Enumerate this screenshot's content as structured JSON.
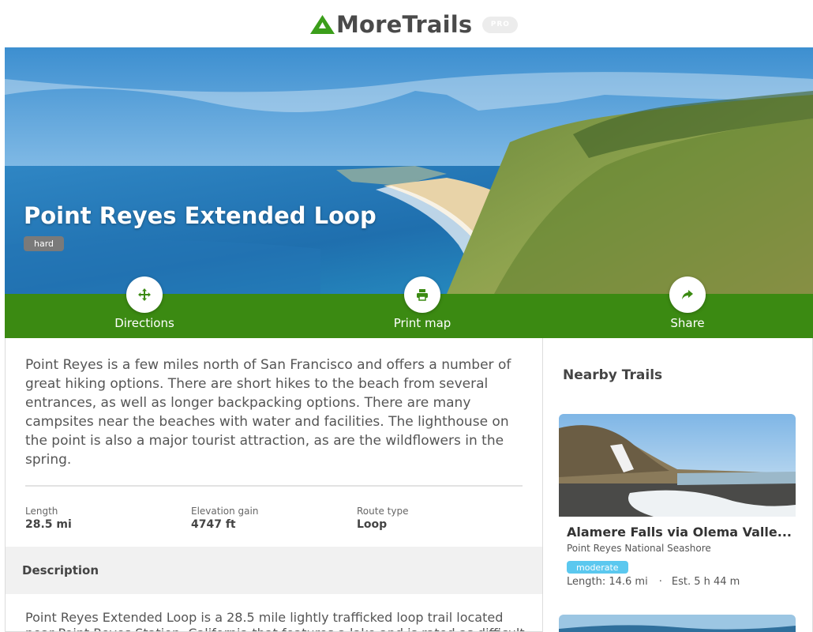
{
  "header": {
    "brand_name": "MoreTrails",
    "pro_badge": "PRO",
    "logo_icon": "mountain-icon",
    "brand_color": "#3b9e1a"
  },
  "hero": {
    "title": "Point Reyes Extended Loop",
    "difficulty": "hard"
  },
  "actions": [
    {
      "label": "Directions",
      "icon": "move-arrows-icon"
    },
    {
      "label": "Print map",
      "icon": "printer-icon"
    },
    {
      "label": "Share",
      "icon": "share-arrow-icon"
    }
  ],
  "accent_color": "#3b8a12",
  "main": {
    "summary": "Point Reyes is a few miles north of San Francisco and offers a number of great hiking options. There are short hikes to the beach from several entrances, as well as longer backpacking options. There are many campsites near the beaches with water and facilities. The lighthouse on the point is also a major tourist attraction, as are the wildflowers in the spring.",
    "stats": [
      {
        "key": "Length",
        "value": "28.5 mi"
      },
      {
        "key": "Elevation gain",
        "value": "4747 ft"
      },
      {
        "key": "Route type",
        "value": "Loop"
      }
    ],
    "description_heading": "Description",
    "description_line1": "Point Reyes Extended Loop is a 28.5 mile lightly trafficked loop trail located",
    "description_line2": "near Point Reyes Station, California that features a lake and is rated as difficult"
  },
  "sidebar": {
    "title": "Nearby Trails",
    "trails": [
      {
        "name": "Alamere Falls via Olema Valle...",
        "park": "Point Reyes National Seashore",
        "difficulty": "moderate",
        "length": "Length: 14.6 mi",
        "separator": "·",
        "estimate": "Est. 5 h 44 m"
      }
    ]
  }
}
